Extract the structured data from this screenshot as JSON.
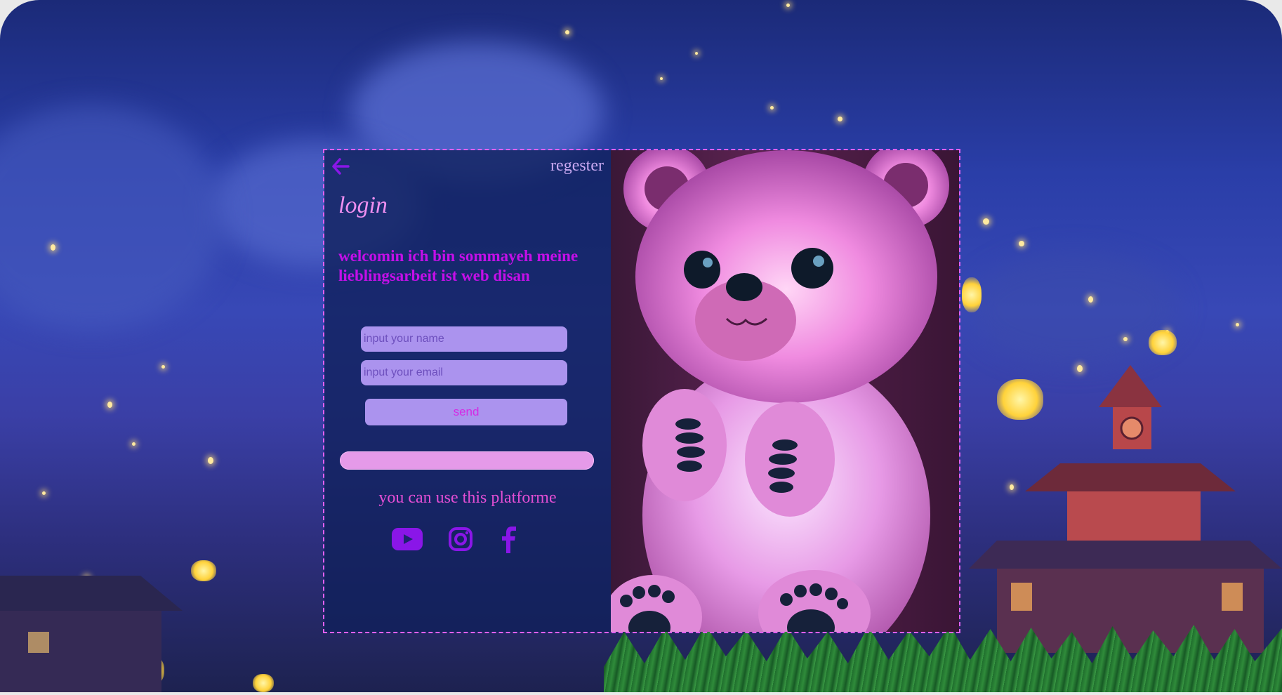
{
  "header": {
    "back_icon": "arrow-left-icon",
    "register_label": "regester"
  },
  "login": {
    "title": "login",
    "welcome_text": "welcomin ich bin sommayeh meine lieblingsarbeit ist web disan"
  },
  "form": {
    "name_placeholder": "input your name",
    "email_placeholder": "input your email",
    "send_label": "send"
  },
  "footer": {
    "platform_text": "you can use this platforme",
    "social_icons": [
      "youtube-icon",
      "instagram-icon",
      "facebook-icon"
    ]
  },
  "colors": {
    "accent": "#8a16e8",
    "title": "#ee8ff0",
    "welcome": "#c40fe8",
    "field_bg": "#ab93ee",
    "bar": "#e59ae9",
    "border": "#e060f0"
  }
}
